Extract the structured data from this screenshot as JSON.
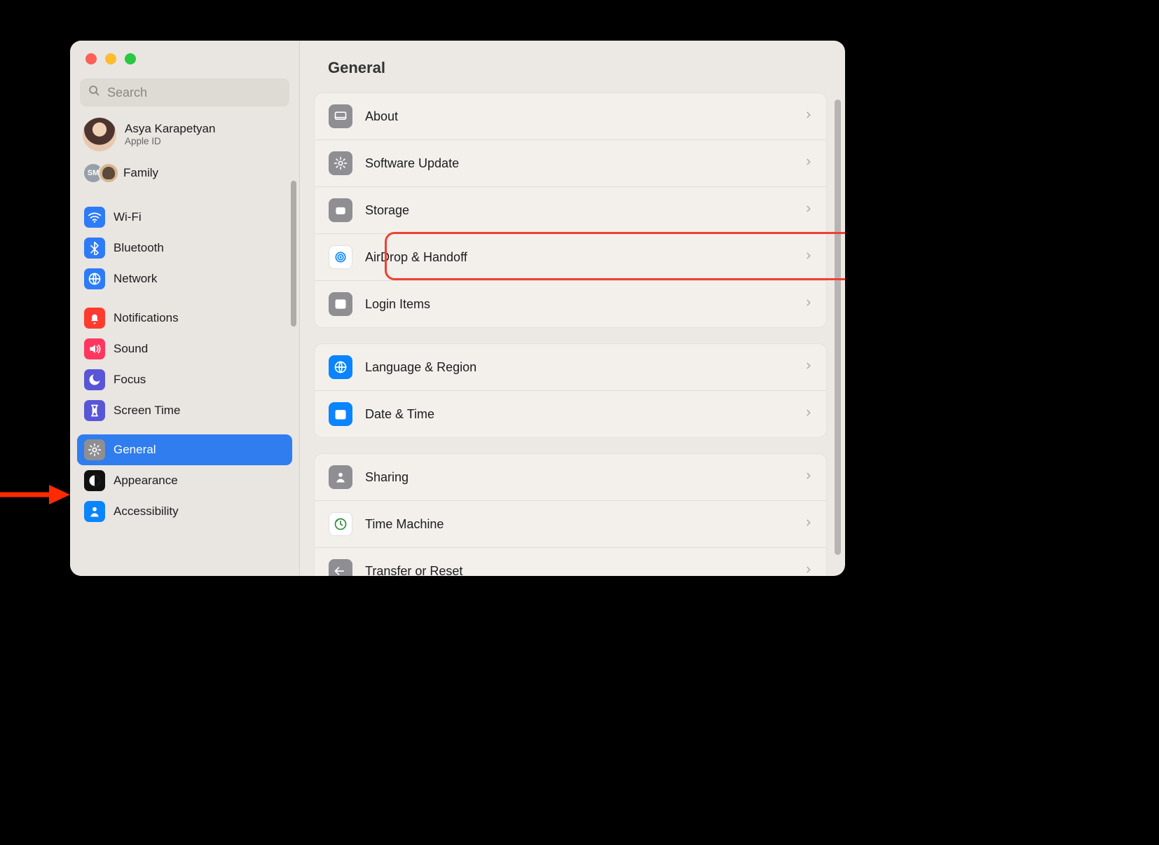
{
  "search": {
    "placeholder": "Search"
  },
  "account": {
    "name": "Asya Karapetyan",
    "sub": "Apple ID"
  },
  "family": {
    "label": "Family",
    "badge": "SM"
  },
  "sidebar": {
    "groups": [
      [
        {
          "id": "wifi",
          "label": "Wi-Fi",
          "color": "#2e7bf6",
          "icon": "wifi"
        },
        {
          "id": "bluetooth",
          "label": "Bluetooth",
          "color": "#2e7bf6",
          "icon": "bluetooth"
        },
        {
          "id": "network",
          "label": "Network",
          "color": "#2e7bf6",
          "icon": "globe"
        }
      ],
      [
        {
          "id": "notifications",
          "label": "Notifications",
          "color": "#ff3b30",
          "icon": "bell"
        },
        {
          "id": "sound",
          "label": "Sound",
          "color": "#ff375f",
          "icon": "speaker"
        },
        {
          "id": "focus",
          "label": "Focus",
          "color": "#5856d6",
          "icon": "moon"
        },
        {
          "id": "screentime",
          "label": "Screen Time",
          "color": "#5856d6",
          "icon": "hourglass"
        }
      ],
      [
        {
          "id": "general",
          "label": "General",
          "color": "#8e8e93",
          "icon": "gear",
          "selected": true
        },
        {
          "id": "appearance",
          "label": "Appearance",
          "color": "#111",
          "icon": "contrast"
        },
        {
          "id": "accessibility",
          "label": "Accessibility",
          "color": "#0b84ff",
          "icon": "person"
        }
      ]
    ]
  },
  "main": {
    "title": "General",
    "panels": [
      [
        {
          "id": "about",
          "label": "About",
          "color": "#8e8e93",
          "icon": "display"
        },
        {
          "id": "softwareupdate",
          "label": "Software Update",
          "color": "#8e8e93",
          "icon": "gear"
        },
        {
          "id": "storage",
          "label": "Storage",
          "color": "#8e8e93",
          "icon": "drive",
          "highlight": true
        },
        {
          "id": "airdrop",
          "label": "AirDrop & Handoff",
          "color": "#ffffff",
          "icon": "airdrop",
          "fg": "#0a84ff",
          "border": true
        },
        {
          "id": "loginitems",
          "label": "Login Items",
          "color": "#8e8e93",
          "icon": "list"
        }
      ],
      [
        {
          "id": "language",
          "label": "Language & Region",
          "color": "#0a84ff",
          "icon": "globe"
        },
        {
          "id": "datetime",
          "label": "Date & Time",
          "color": "#0a84ff",
          "icon": "calendar"
        }
      ],
      [
        {
          "id": "sharing",
          "label": "Sharing",
          "color": "#8e8e93",
          "icon": "person"
        },
        {
          "id": "timemachine",
          "label": "Time Machine",
          "color": "#ffffff",
          "icon": "clockarrow",
          "fg": "#2a8a3c",
          "border": true
        },
        {
          "id": "transfer",
          "label": "Transfer or Reset",
          "color": "#8e8e93",
          "icon": "arrowback"
        }
      ]
    ]
  }
}
